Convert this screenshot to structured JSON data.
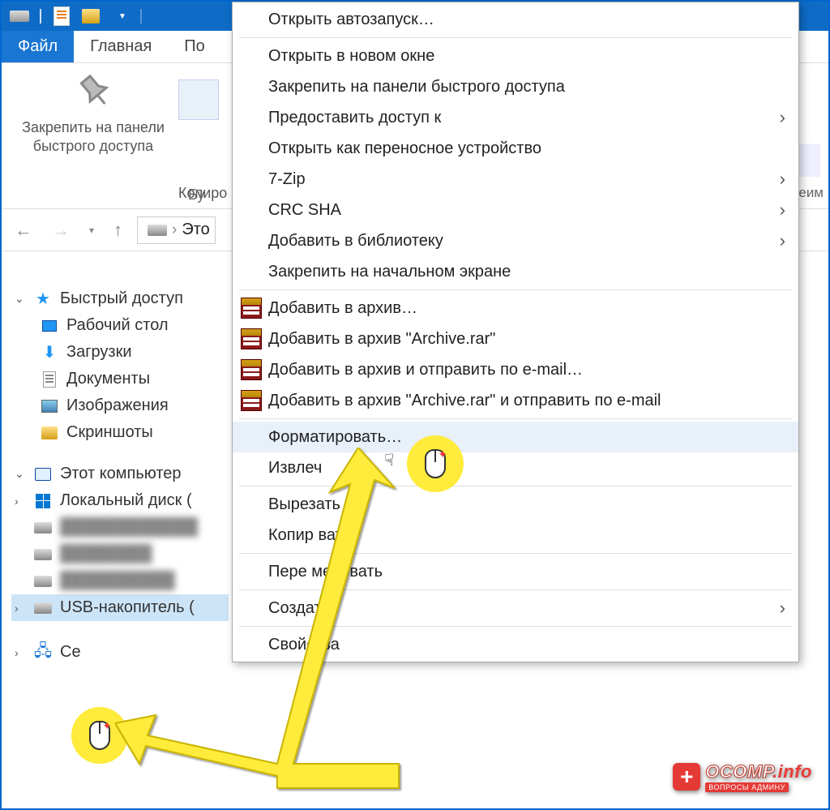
{
  "tabs": {
    "file": "Файл",
    "main": "Главная",
    "share_partial": "По"
  },
  "ribbon": {
    "pin_label_l1": "Закрепить на панели",
    "pin_label_l2": "быстрого доступа",
    "copy_partial": "Копиро",
    "group_partial": "Бу",
    "right_partial": "реим"
  },
  "breadcrumb": {
    "this_partial": "Это"
  },
  "tree": {
    "quick_access": "Быстрый доступ",
    "desktop": "Рабочий стол",
    "downloads": "Загрузки",
    "documents": "Документы",
    "pictures": "Изображения",
    "screenshots": "Скриншоты",
    "this_pc": "Этот компьютер",
    "local_disk": "Локальный диск (",
    "usb_drive": "USB-накопитель (",
    "network_partial": "Се"
  },
  "ctx": {
    "autorun": "Открыть автозапуск…",
    "new_window": "Открыть в новом окне",
    "pin_quick": "Закрепить на панели быстрого доступа",
    "grant_access": "Предоставить доступ к",
    "portable": "Открыть как переносное устройство",
    "sevenzip": "7-Zip",
    "crc": "CRC SHA",
    "add_library": "Добавить в библиотеку",
    "pin_start": "Закрепить на начальном экране",
    "add_archive": "Добавить в архив…",
    "add_archive_rar": "Добавить в архив \"Archive.rar\"",
    "add_email": "Добавить в архив и отправить по e-mail…",
    "add_rar_email": "Добавить в архив \"Archive.rar\" и отправить по e-mail",
    "format": "Форматировать…",
    "eject_partial": "Извлеч",
    "cut": "Вырезать",
    "copy": "Копир     вать",
    "rename": "Пере     меновать",
    "create": "Создать",
    "properties": "Свойства"
  },
  "watermark": {
    "brand": "OCOMP",
    "tld": ".info",
    "sub": "ВОПРОСЫ АДМИНУ"
  }
}
